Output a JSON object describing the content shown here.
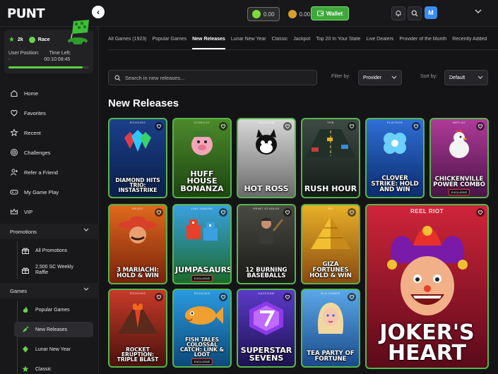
{
  "app": {
    "logo": "PUNT"
  },
  "topbar": {
    "sc_balance": "0.00",
    "gc_balance": "0.00",
    "wallet_label": "Wallet",
    "avatar_letter": "M"
  },
  "rank": {
    "points": "2k",
    "race_label": "Race",
    "position_label": "User Position:",
    "position_value": "-",
    "time_left_label": "Time Left:",
    "time_left_value": "00:10:08:45",
    "progress_fraction": 0.92
  },
  "sidebar": {
    "items": [
      {
        "label": "Home",
        "icon": "home-icon"
      },
      {
        "label": "Favorites",
        "icon": "heart-icon"
      },
      {
        "label": "Recent",
        "icon": "star-icon"
      },
      {
        "label": "Challenges",
        "icon": "target-icon"
      },
      {
        "label": "Refer a Friend",
        "icon": "user-plus-icon"
      },
      {
        "label": "My Game Play",
        "icon": "gamepad-icon"
      },
      {
        "label": "VIP",
        "icon": "crown-icon"
      }
    ],
    "promotions_header": "Promotions",
    "promotions": [
      {
        "label": "All Promotions",
        "icon": "gift-icon"
      },
      {
        "label": "2,500 SC Weekly Raffle",
        "icon": "gift-icon"
      }
    ],
    "games_header": "Games",
    "games": [
      {
        "label": "Popular Games",
        "icon": "fire-icon"
      },
      {
        "label": "New Releases",
        "icon": "rocket-icon"
      },
      {
        "label": "Lunar New Year",
        "icon": "lantern-icon"
      },
      {
        "label": "Classic",
        "icon": "classic-icon"
      }
    ]
  },
  "tabs": [
    "All Games (1923)",
    "Popular Games",
    "New Releases",
    "Lunar New Year",
    "Classic",
    "Jackpot",
    "Top 20 In Your State",
    "Live Dealers",
    "Provider of the Month",
    "Recently Added"
  ],
  "active_tab": "New Releases",
  "search": {
    "placeholder": "Search in new releases..."
  },
  "filter": {
    "label": "Filter by:",
    "value": "Provider"
  },
  "sort": {
    "label": "Sort by:",
    "value": "Default"
  },
  "section_title": "New Releases",
  "games": [
    {
      "provider": "ROOGING",
      "title": "Diamond Hits Trio: Instastrike",
      "bg": "#1b3f8a",
      "bg2": "#0b1f4a",
      "art": "diamond",
      "exclusive": ""
    },
    {
      "provider": "ICONIC21",
      "title": "Huff House Bonanza",
      "bg": "#4c8a2a",
      "bg2": "#1d4512",
      "art": "pig",
      "exclusive": ""
    },
    {
      "provider": "HACKSAW",
      "title": "Hot Ross",
      "bg": "#d8d8d8",
      "bg2": "#6a6a6a",
      "art": "cat",
      "exclusive": ""
    },
    {
      "provider": "THB",
      "title": "Rush Hour",
      "bg": "#3e4a44",
      "bg2": "#141c18",
      "art": "road",
      "exclusive": ""
    },
    {
      "provider": "PLAYSON",
      "title": "Clover Strike: Hold and Win",
      "bg": "#2f6fd6",
      "bg2": "#0c2c6e",
      "art": "clover",
      "exclusive": ""
    },
    {
      "provider": "NEFLAY",
      "title": "Chickenville Power Combo",
      "bg": "#b03a9a",
      "bg2": "#4a1546",
      "art": "chicken",
      "exclusive": "EXCLUSIVE"
    },
    {
      "provider": "ENJOY",
      "title": "3 Mariachi: Hold & Win",
      "bg": "#e06a1c",
      "bg2": "#7a220c",
      "art": "mariachi",
      "exclusive": ""
    },
    {
      "provider": "JINX GAMING",
      "title": "Jumpasaurs!",
      "bg": "#3aa0e0",
      "bg2": "#1a6a2a",
      "art": "dino",
      "exclusive": "EXCLUSIVE"
    },
    {
      "provider": "PRINT STUDIOS",
      "title": "12 Burning Baseballs",
      "bg": "#4a4a44",
      "bg2": "#1a1a18",
      "art": "player",
      "exclusive": ""
    },
    {
      "provider": "RG",
      "title": "Giza Fortunes Hold & Win",
      "bg": "#e8b028",
      "bg2": "#8a4a10",
      "art": "pyramid",
      "exclusive": ""
    },
    {
      "provider": "REEL RIOT",
      "title": "Joker's Heart",
      "bg": "#d0243a",
      "bg2": "#5a0a1a",
      "art": "joker",
      "exclusive": ""
    },
    {
      "provider": "ROOGING",
      "title": "Rocket Eruption: Triple Blast",
      "bg": "#c83a2a",
      "bg2": "#4a120c",
      "art": "volcano",
      "exclusive": ""
    },
    {
      "provider": "ROOGING",
      "title": "Fish Tales Colossal Catch: Link & Loot",
      "bg": "#2a9ae0",
      "bg2": "#0c4a7a",
      "art": "fish",
      "exclusive": "EXCLUSIVE"
    },
    {
      "provider": "HACKSAW",
      "title": "Superstar Sevens",
      "bg": "#5a3ac8",
      "bg2": "#1c1250",
      "art": "seven",
      "exclusive": ""
    },
    {
      "provider": "ELA GAMES",
      "title": "Tea Party of Fortune",
      "bg": "#5aa8e8",
      "bg2": "#1a4a8a",
      "art": "lady",
      "exclusive": ""
    }
  ]
}
